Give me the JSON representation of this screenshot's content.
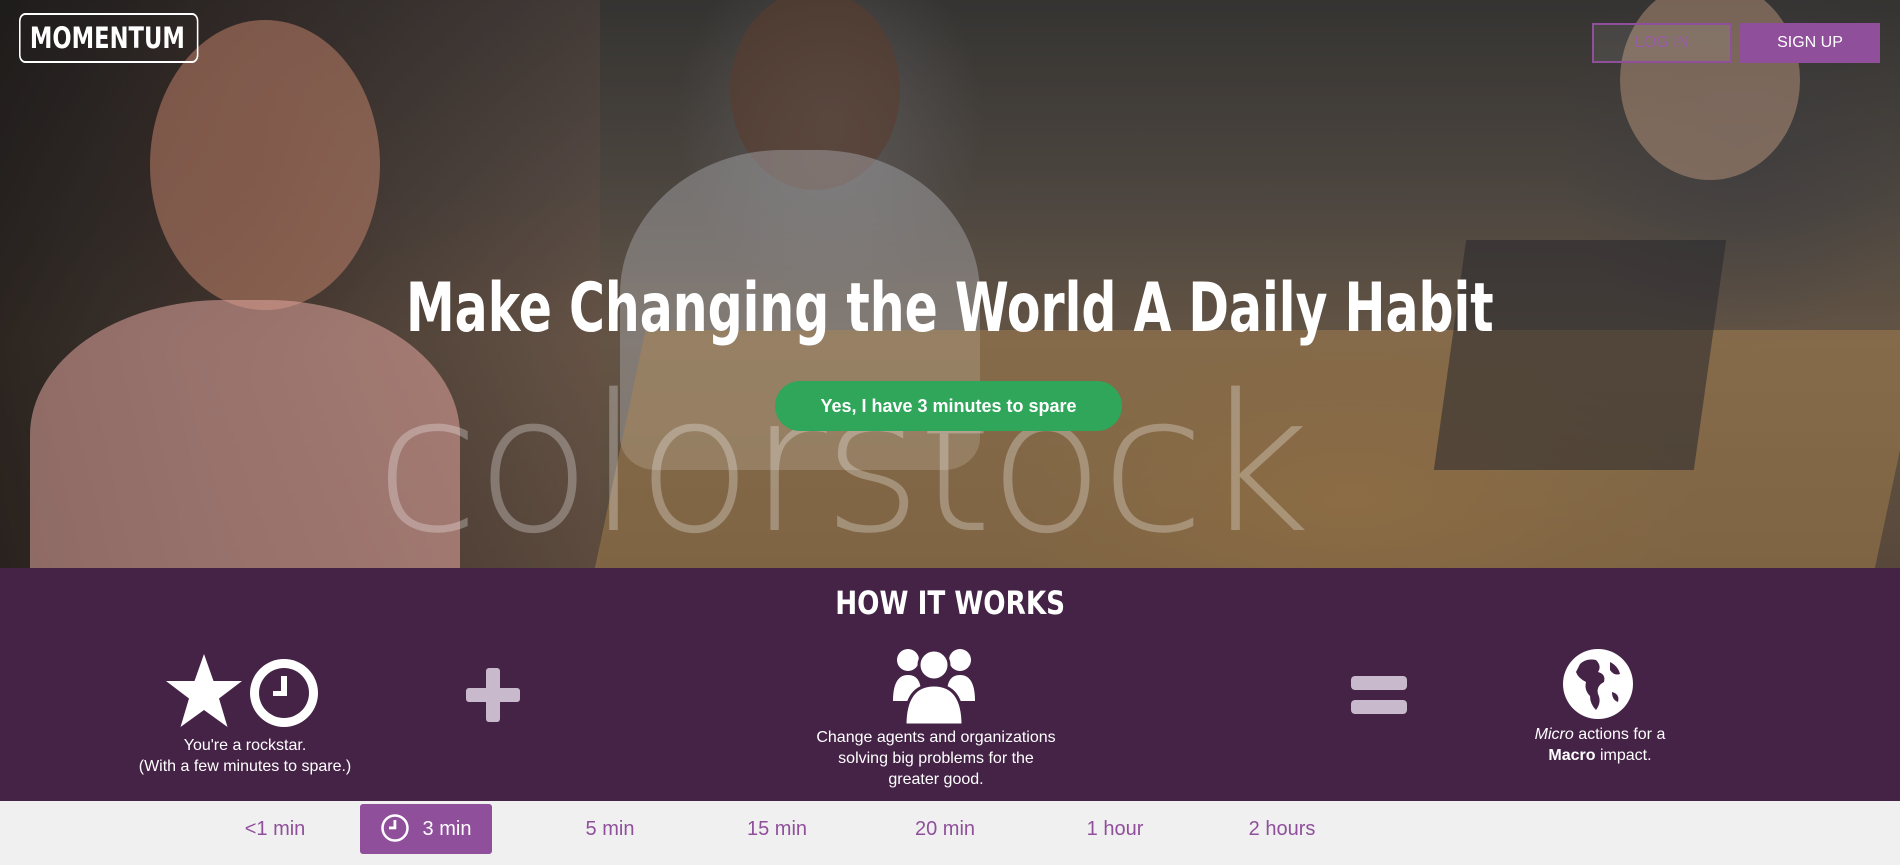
{
  "header": {
    "logo": "MOMENTUM",
    "login_label": "LOG IN",
    "signup_label": "SIGN UP"
  },
  "hero": {
    "headline": "Make Changing the World A Daily Habit",
    "cta_label": "Yes, I have 3 minutes to spare",
    "watermark": "colorstock"
  },
  "how_it_works": {
    "title": "HOW IT WORKS",
    "step1_line1": "You're a rockstar.",
    "step1_line2": "(With a few minutes to spare.)",
    "step2_line1": "Change agents and organizations",
    "step2_line2": "solving big problems for the",
    "step2_line3": "greater good.",
    "step3_em": "Micro",
    "step3_rest": " actions for a",
    "step3_strong": "Macro",
    "step3_end": " impact."
  },
  "time_tabs": {
    "items": [
      "<1 min",
      "3 min",
      "5 min",
      "15 min",
      "20 min",
      "1 hour",
      "2 hours"
    ],
    "selected": "3 min"
  },
  "colors": {
    "accent_purple": "#8f4f9b",
    "section_bg": "#452347",
    "cta_green": "#2fa65a"
  },
  "icons": [
    "star-icon",
    "clock-icon",
    "plus-icon",
    "users-icon",
    "equals-icon",
    "globe-icon",
    "clock-tab-icon"
  ]
}
